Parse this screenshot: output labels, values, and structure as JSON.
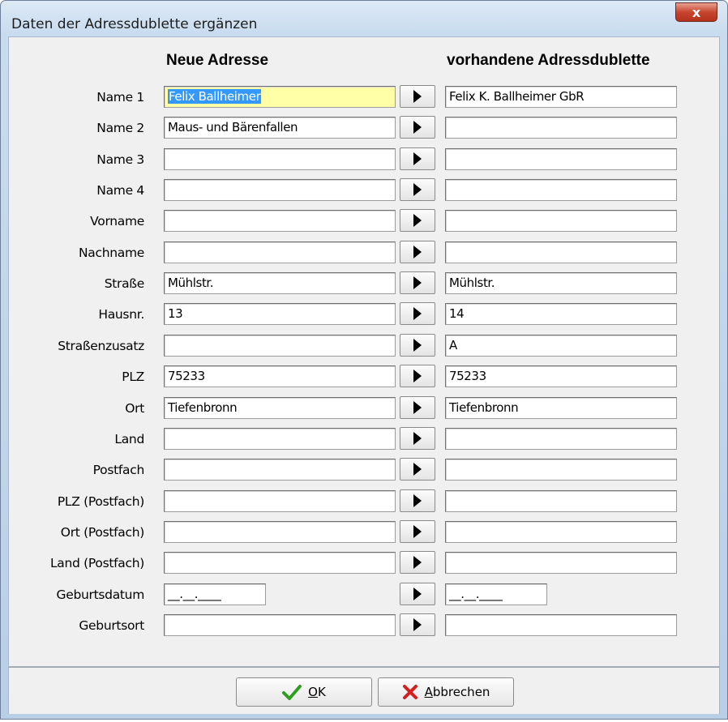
{
  "window": {
    "title": "Daten der Adressdublette ergänzen",
    "close_label": "x"
  },
  "headers": {
    "new": "Neue Adresse",
    "existing": "vorhandene Adressdublette"
  },
  "rows": [
    {
      "label": "Name 1",
      "new": "Felix Ballheimer",
      "existing": "Felix K.  Ballheimer GbR"
    },
    {
      "label": "Name 2",
      "new": "Maus- und Bärenfallen",
      "existing": ""
    },
    {
      "label": "Name 3",
      "new": "",
      "existing": ""
    },
    {
      "label": "Name 4",
      "new": "",
      "existing": ""
    },
    {
      "label": "Vorname",
      "new": "",
      "existing": ""
    },
    {
      "label": "Nachname",
      "new": "",
      "existing": ""
    },
    {
      "label": "Straße",
      "new": "Mühlstr.",
      "existing": "Mühlstr."
    },
    {
      "label": "Hausnr.",
      "new": "13",
      "existing": "14"
    },
    {
      "label": "Straßenzusatz",
      "new": "",
      "existing": "A"
    },
    {
      "label": "PLZ",
      "new": "75233",
      "existing": "75233"
    },
    {
      "label": "Ort",
      "new": "Tiefenbronn",
      "existing": "Tiefenbronn"
    },
    {
      "label": "Land",
      "new": "",
      "existing": ""
    },
    {
      "label": "Postfach",
      "new": "",
      "existing": ""
    },
    {
      "label": "PLZ (Postfach)",
      "new": "",
      "existing": ""
    },
    {
      "label": "Ort (Postfach)",
      "new": "",
      "existing": ""
    },
    {
      "label": "Land (Postfach)",
      "new": "",
      "existing": ""
    },
    {
      "label": "Geburtsdatum",
      "new": "__.__.____",
      "existing": "__.__.____"
    },
    {
      "label": "Geburtsort",
      "new": "",
      "existing": ""
    }
  ],
  "buttons": {
    "ok": "OK",
    "cancel": "Abbrechen"
  },
  "colors": {
    "ok_icon": "#2e9e1f",
    "cancel_icon": "#d21f1f",
    "focus_field": "#ffffa8",
    "selection": "#3399ff"
  }
}
